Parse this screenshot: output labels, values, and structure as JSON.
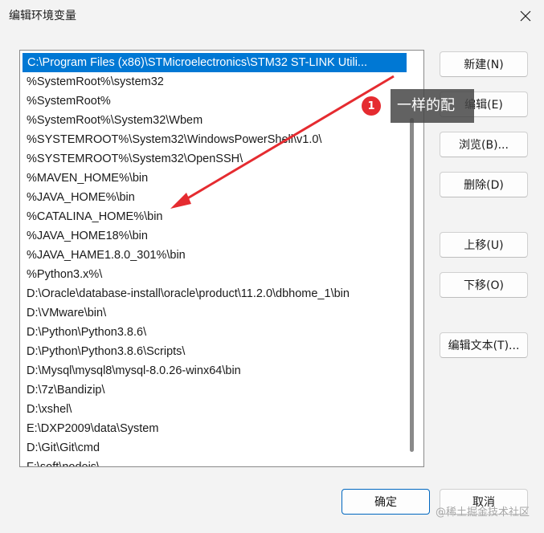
{
  "window": {
    "title": "编辑环境变量"
  },
  "list": {
    "items": [
      "C:\\Program Files (x86)\\STMicroelectronics\\STM32 ST-LINK Utili...",
      "%SystemRoot%\\system32",
      "%SystemRoot%",
      "%SystemRoot%\\System32\\Wbem",
      "%SYSTEMROOT%\\System32\\WindowsPowerShell\\v1.0\\",
      "%SYSTEMROOT%\\System32\\OpenSSH\\",
      "%MAVEN_HOME%\\bin",
      "%JAVA_HOME%\\bin",
      "%CATALINA_HOME%\\bin",
      "%JAVA_HOME18%\\bin",
      "%JAVA_HAME1.8.0_301%\\bin",
      "%Python3.x%\\",
      "D:\\Oracle\\database-install\\oracle\\product\\11.2.0\\dbhome_1\\bin",
      "D:\\VMware\\bin\\",
      "D:\\Python\\Python3.8.6\\",
      "D:\\Python\\Python3.8.6\\Scripts\\",
      "D:\\Mysql\\mysql8\\mysql-8.0.26-winx64\\bin",
      "D:\\7z\\Bandizip\\",
      "D:\\xshel\\",
      "E:\\DXP2009\\data\\System",
      "D:\\Git\\Git\\cmd",
      "F:\\soft\\nodejs\\"
    ]
  },
  "buttons": {
    "new": "新建(N)",
    "edit": "编辑(E)",
    "browse": "浏览(B)...",
    "delete": "删除(D)",
    "move_up": "上移(U)",
    "move_down": "下移(O)",
    "edit_text": "编辑文本(T)...",
    "ok": "确定",
    "cancel": "取消"
  },
  "annotation": {
    "badge": "1",
    "text": "一样的配"
  },
  "watermark": "@稀土掘金技术社区",
  "colors": {
    "selection": "#0078d4",
    "annotation_red": "#e52b30"
  }
}
